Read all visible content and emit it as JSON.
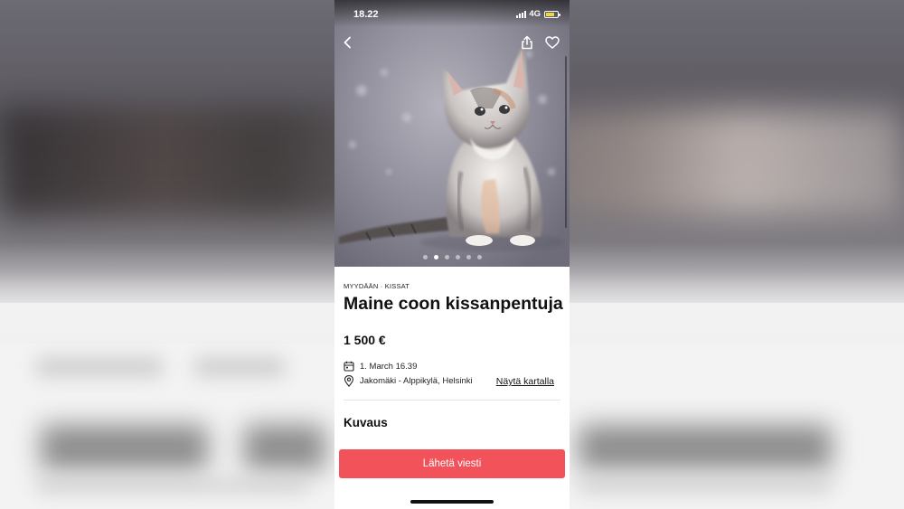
{
  "status_bar": {
    "time": "18.22",
    "network": "4G"
  },
  "listing": {
    "breadcrumb": "MYYDÄÄN · KISSAT",
    "title": "Maine coon kissanpentuja",
    "price": "1 500 €",
    "date": "1. March 16.39",
    "location": "Jakomäki - Alppikylä, Helsinki",
    "map_link": "Näytä kartalla",
    "description_heading": "Kuvaus"
  },
  "gallery": {
    "image_count": 6,
    "active_index": 1,
    "image_subject": "maine-coon-kitten-photo"
  },
  "actions": {
    "send_message": "Lähetä viesti"
  },
  "icons": {
    "back": "back-arrow-icon",
    "share": "share-icon",
    "favorite": "heart-icon",
    "date": "calendar-icon",
    "location": "location-pin-icon"
  },
  "colors": {
    "cta": "#f25259",
    "battery": "#f5d442"
  }
}
